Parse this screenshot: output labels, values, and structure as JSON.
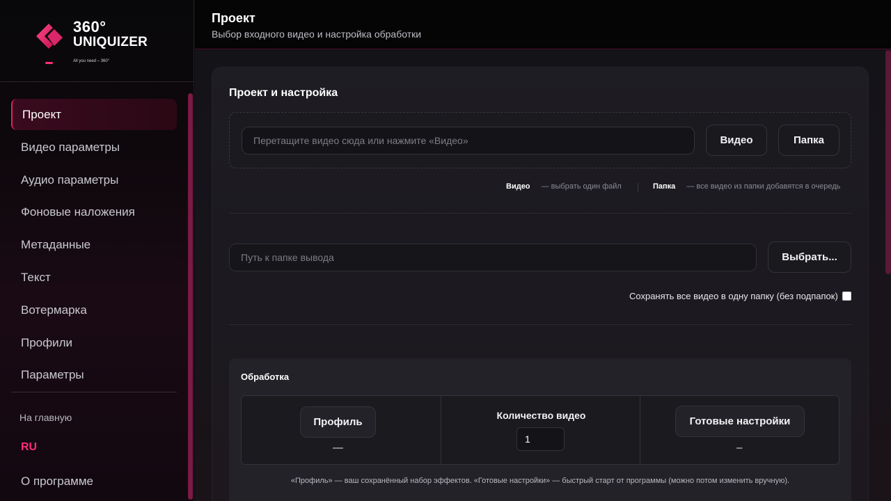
{
  "brand": {
    "line1": "360°",
    "line2": "UNIQUIZER",
    "tagline": "All you need – 360°",
    "accent": "#ff2d7a"
  },
  "sidebar": {
    "items": [
      {
        "label": "Проект",
        "active": true
      },
      {
        "label": "Видео параметры"
      },
      {
        "label": "Аудио параметры"
      },
      {
        "label": "Фоновые наложения"
      },
      {
        "label": "Метаданные"
      },
      {
        "label": "Текст"
      },
      {
        "label": "Вотермарка"
      },
      {
        "label": "Профили"
      },
      {
        "label": "Параметры"
      }
    ],
    "home": "На главную",
    "lang": "RU",
    "about": "О программе"
  },
  "header": {
    "title": "Проект",
    "subtitle": "Выбор входного видео и настройка обработки"
  },
  "project": {
    "title": "Проект и настройка",
    "drop_placeholder": "Перетащите видео сюда или нажмите «Видео»",
    "video_button": "Видео",
    "folder_button": "Папка",
    "hint_video_key": "Видео",
    "hint_video_text": "— выбрать один файл",
    "hint_folder_key": "Папка",
    "hint_folder_text": "— все видео из папки добавятся в очередь",
    "output_placeholder": "Путь к папке вывода",
    "choose_button": "Выбрать...",
    "save_one_folder": "Сохранять все видео в одну папку (без подпапок)",
    "save_one_folder_checked": false
  },
  "processing": {
    "title": "Обработка",
    "profile_button": "Профиль",
    "profile_value": "—",
    "count_label": "Количество видео",
    "count_value": "1",
    "presets_button": "Готовые настройки",
    "presets_value": "–",
    "note": "«Профиль» — ваш сохранённый набор эффектов. «Готовые настройки» — быстрый старт от программы (можно потом изменить вручную)."
  }
}
